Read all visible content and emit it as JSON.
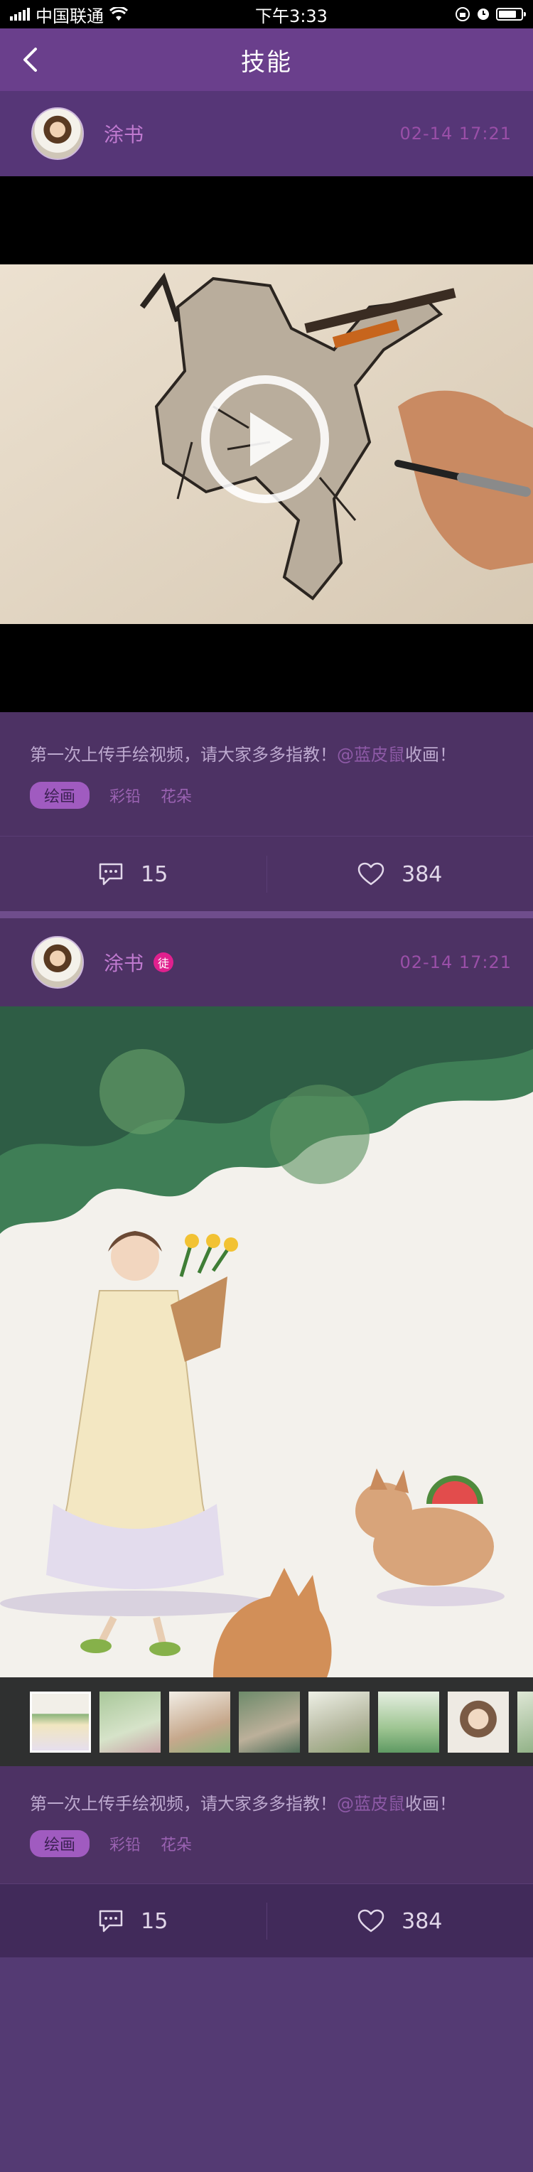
{
  "status_bar": {
    "carrier": "中国联通",
    "time": "下午3:33"
  },
  "nav": {
    "title": "技能"
  },
  "posts": [
    {
      "author": "涂书",
      "time": "02-14  17:21",
      "text": "第一次上传手绘视频，请大家多多指教！",
      "mention": "@蓝皮鼠",
      "text_end": "收画！",
      "tags": [
        "绘画",
        "彩铅",
        "花朵"
      ],
      "comments": "15",
      "likes": "384"
    },
    {
      "author": "涂书",
      "badge": "徒",
      "time": "02-14  17:21",
      "text": "第一次上传手绘视频，请大家多多指教！",
      "mention": "@蓝皮鼠",
      "text_end": "收画！",
      "tags": [
        "绘画",
        "彩铅",
        "花朵"
      ],
      "comments": "15",
      "likes": "384"
    }
  ],
  "colors": {
    "nav": "#6a3f8c",
    "background": "#4d3264",
    "accent": "#a05bc0",
    "badge": "#e0208e"
  }
}
